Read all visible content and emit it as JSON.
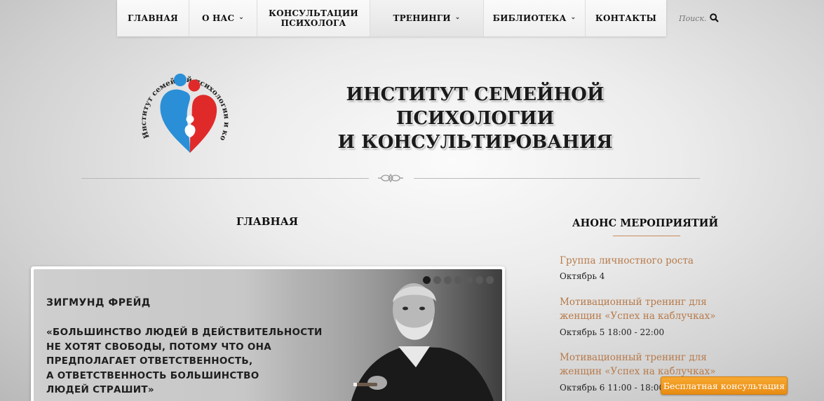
{
  "nav": {
    "items": [
      {
        "label": "ГЛАВНАЯ",
        "dropdown": false
      },
      {
        "label": "О НАС",
        "dropdown": true
      },
      {
        "label": "КОНСУЛЬТАЦИИ\nПСИХОЛОГА",
        "dropdown": false
      },
      {
        "label": "ТРЕНИНГИ",
        "dropdown": true
      },
      {
        "label": "БИБЛИОТЕКА",
        "dropdown": true
      },
      {
        "label": "КОНТАКТЫ",
        "dropdown": false
      }
    ],
    "search_placeholder": "Поиск..."
  },
  "header": {
    "logo_text": "Институт семейной психологии и консультирования",
    "title_line1": "ИНСТИТУТ СЕМЕЙНОЙ ПСИХОЛОГИИ",
    "title_line2": "И КОНСУЛЬТИРОВАНИЯ"
  },
  "main": {
    "page_title": "ГЛАВНАЯ",
    "slider": {
      "author": "ЗИГМУНД ФРЕЙД",
      "quote": "«БОЛЬШИНСТВО ЛЮДЕЙ В ДЕЙСТВИТЕЛЬНОСТИ\nНЕ ХОТЯТ СВОБОДЫ, ПОТОМУ ЧТО ОНА\nПРЕДПОЛАГАЕТ ОТВЕТСТВЕННОСТЬ,\nА ОТВЕТСТВЕННОСТЬ БОЛЬШИНСТВО\nЛЮДЕЙ СТРАШИТ»",
      "slide_count": 7,
      "active_slide": 1
    }
  },
  "sidebar": {
    "title": "АНОНС МЕРОПРИЯТИЙ",
    "events": [
      {
        "title": "Группа личностного роста",
        "date": "Октябрь 4"
      },
      {
        "title": "Мотивационный тренинг для женщин «Успех на каблучках»",
        "date": "Октябрь 5 18:00 - 22:00"
      },
      {
        "title": "Мотивационный тренинг для женщин «Успех на каблучках»",
        "date": "Октябрь 6 11:00 - 18:00"
      }
    ]
  },
  "consult_button": "Бесплатная консультация",
  "colors": {
    "accent_link": "#b77a4a",
    "button_orange": "#f09a20",
    "logo_blue": "#2a8fd6",
    "logo_red": "#e02a2a"
  }
}
